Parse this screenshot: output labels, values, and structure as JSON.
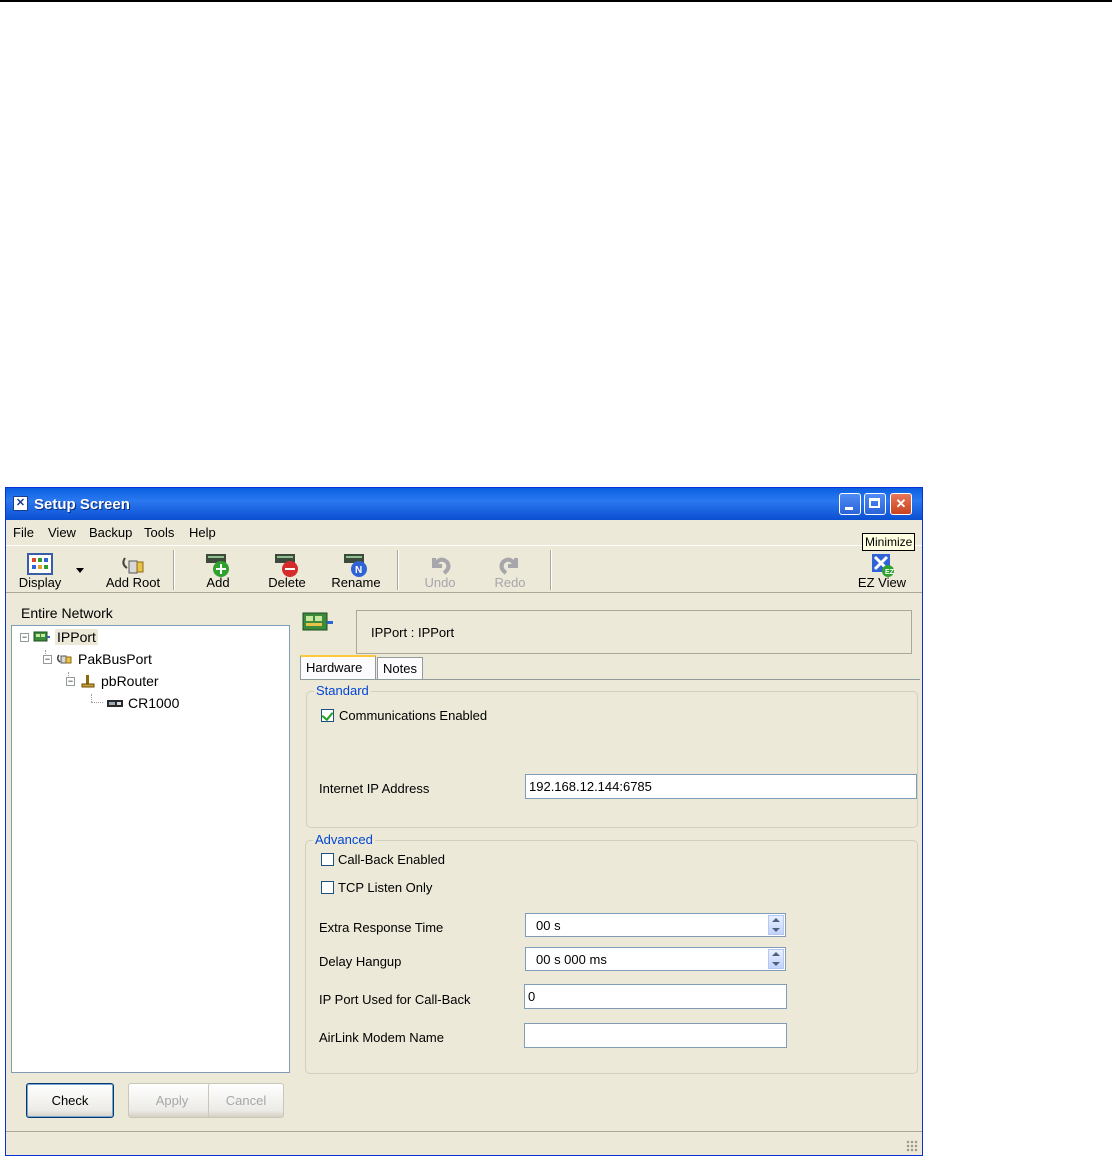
{
  "window": {
    "title": "Setup Screen"
  },
  "menu": [
    "File",
    "View",
    "Backup",
    "Tools",
    "Help"
  ],
  "toolbar": {
    "display": "Display",
    "add_root": "Add Root",
    "add": "Add",
    "delete": "Delete",
    "rename": "Rename",
    "undo": "Undo",
    "redo": "Redo",
    "ez_view": "EZ View"
  },
  "tooltip": "Minimize",
  "left_pane": {
    "header": "Entire Network",
    "tree": [
      {
        "label": "IPPort",
        "icon": "ipport-icon",
        "level": 0,
        "selected": true
      },
      {
        "label": "PakBusPort",
        "icon": "pakbusport-icon",
        "level": 1
      },
      {
        "label": "pbRouter",
        "icon": "pbrouter-icon",
        "level": 2
      },
      {
        "label": "CR1000",
        "icon": "cr1000-icon",
        "level": 3
      }
    ],
    "buttons": {
      "check": "Check",
      "apply": "Apply",
      "cancel": "Cancel"
    }
  },
  "right_pane": {
    "header": "IPPort : IPPort",
    "tabs": [
      "Hardware",
      "Notes"
    ],
    "standard": {
      "title": "Standard",
      "comm_enabled_label": "Communications Enabled",
      "comm_enabled": true,
      "ip_label": "Internet IP Address",
      "ip_value": "192.168.12.144:6785"
    },
    "advanced": {
      "title": "Advanced",
      "callback_label": "Call-Back Enabled",
      "callback": false,
      "tcp_listen_label": "TCP Listen Only",
      "tcp_listen": false,
      "extra_response_label": "Extra Response Time",
      "extra_response_value": "00 s",
      "delay_hangup_label": "Delay Hangup",
      "delay_hangup_value": "00 s 000 ms",
      "ip_port_callback_label": "IP Port Used for Call-Back",
      "ip_port_callback_value": "0",
      "airlink_label": "AirLink Modem Name",
      "airlink_value": ""
    }
  },
  "colors": {
    "titlebar": "#0a5fe0",
    "chrome": "#ece9d8",
    "group_title": "#0046d5",
    "tab_highlight": "#ffc83c"
  }
}
